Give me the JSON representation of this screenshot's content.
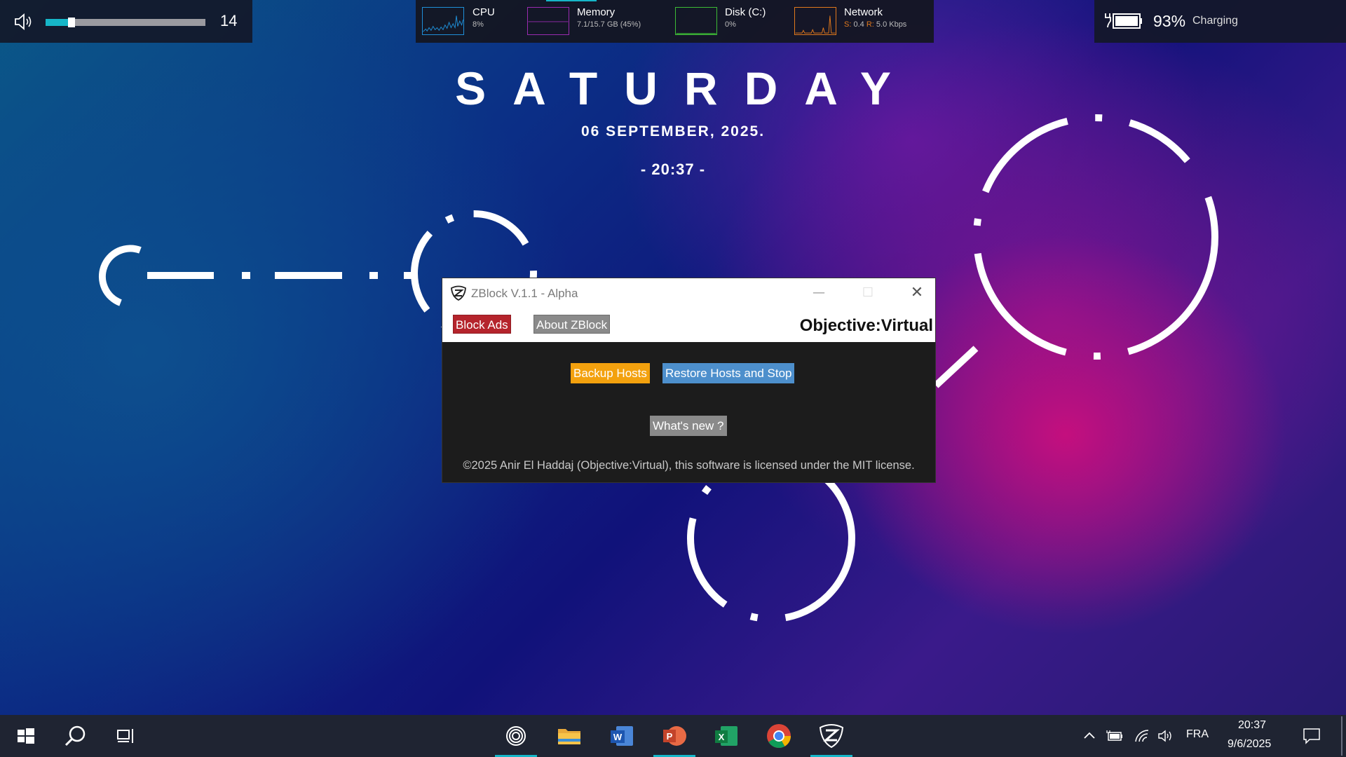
{
  "volume": {
    "level": 14,
    "fraction": 0.14,
    "icon": "speaker-icon"
  },
  "monitor": {
    "cpu": {
      "title": "CPU",
      "value": "8%",
      "color": "#1f8fd8"
    },
    "memory": {
      "title": "Memory",
      "value": "7.1/15.7 GB (45%)",
      "color": "#9a2bb0"
    },
    "disk": {
      "title": "Disk (C:)",
      "value": "0%",
      "color": "#3dbb36"
    },
    "network": {
      "title": "Network",
      "send_label": "S:",
      "send": "0.4",
      "recv_label": "R:",
      "recv": "5.0 Kbps",
      "color": "#e0781c"
    }
  },
  "battery": {
    "percent": "93%",
    "state": "Charging"
  },
  "clock_widget": {
    "day": "SATURDAY",
    "date": "06 SEPTEMBER, 2025.",
    "time": "- 20:37 -"
  },
  "window": {
    "title": "ZBlock V.1.1 - Alpha",
    "tabs": {
      "block": "Block Ads",
      "about": "About ZBlock"
    },
    "brand": "Objective:Virtual",
    "buttons": {
      "backup": "Backup Hosts",
      "restore": "Restore Hosts and Stop",
      "whats_new": "What's new ?"
    },
    "copyright": "©2025 Anir El Haddaj (Objective:Virtual), this software is licensed under the MIT license.",
    "controls": {
      "minimize": "—",
      "maximize": "☐",
      "close": "✕"
    }
  },
  "taskbar": {
    "apps": [
      "start-icon",
      "search-icon",
      "task-view-icon",
      "cortana-icon",
      "file-explorer-icon",
      "word-icon",
      "powerpoint-icon",
      "excel-icon",
      "chrome-icon",
      "zblock-icon"
    ],
    "tray": {
      "language": "FRA",
      "time": "20:37",
      "date": "9/6/2025"
    }
  },
  "colors": {
    "accent": "#16b6c8",
    "block_red": "#b5242c",
    "backup_orange": "#f3a10e",
    "restore_blue": "#4d8fcc"
  }
}
